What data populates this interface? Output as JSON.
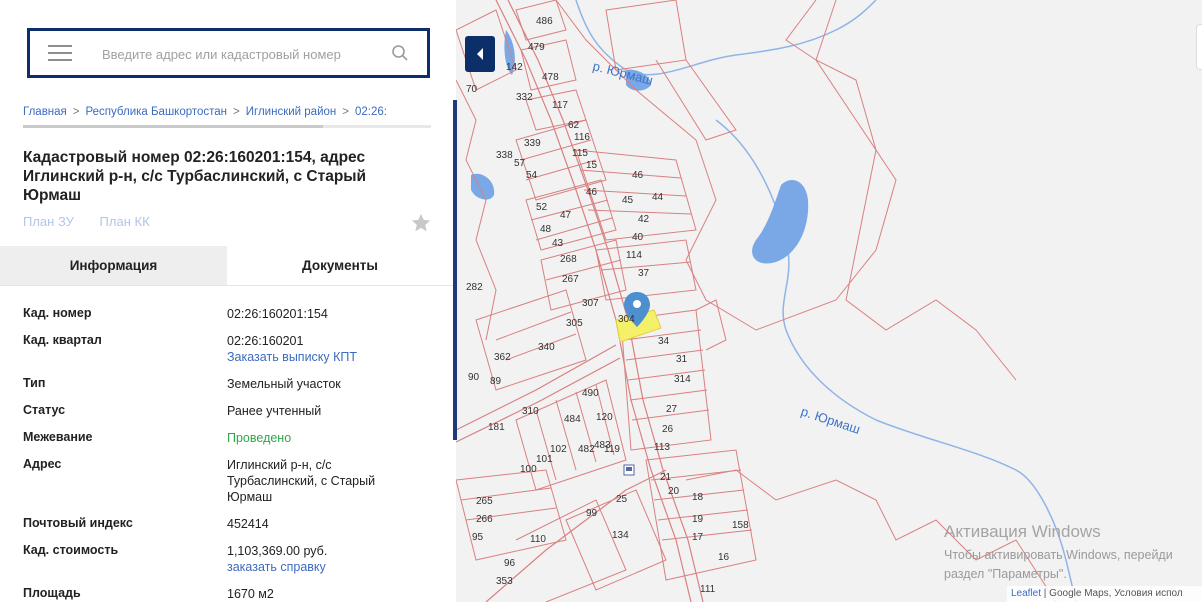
{
  "search": {
    "placeholder": "Введите адрес или кадастровый номер"
  },
  "breadcrumb": {
    "items": [
      "Главная",
      "Республика Башкортостан",
      "Иглинский район",
      "02:26:"
    ],
    "separator": ">"
  },
  "object": {
    "title": "Кадастровый номер 02:26:160201:154, адрес Иглинский р-н, с/с Турбаслинский, с Старый Юрмаш",
    "plan_zu": "План ЗУ",
    "plan_kk": "План КК"
  },
  "tabs": {
    "info": "Информация",
    "docs": "Документы"
  },
  "properties": {
    "cad_number": {
      "label": "Кад. номер",
      "value": "02:26:160201:154"
    },
    "cad_quarter": {
      "label": "Кад. квартал",
      "value": "02:26:160201",
      "link": "Заказать выписку КПТ"
    },
    "type": {
      "label": "Тип",
      "value": "Земельный участок"
    },
    "status": {
      "label": "Статус",
      "value": "Ранее учтенный"
    },
    "survey": {
      "label": "Межевание",
      "value": "Проведено"
    },
    "address": {
      "label": "Адрес",
      "value": "Иглинский р-н, с/с Турбаслинский, с Старый Юрмаш"
    },
    "postcode": {
      "label": "Почтовый индекс",
      "value": "452414"
    },
    "cad_cost": {
      "label": "Кад. стоимость",
      "value": "1,103,369.00 руб.",
      "link": "заказать справку"
    },
    "area": {
      "label": "Площадь",
      "value": "1670 м2"
    }
  },
  "map": {
    "river_label_1": "р. Юрмаш",
    "river_label_2": "р. Юрмаш",
    "parcel_labels": [
      "486",
      "479",
      "478",
      "142",
      "70",
      "332",
      "117",
      "62",
      "116",
      "115",
      "338",
      "339",
      "57",
      "54",
      "15",
      "46",
      "46",
      "45",
      "44",
      "42",
      "52",
      "48",
      "47",
      "43",
      "40",
      "114",
      "37",
      "268",
      "267",
      "282",
      "307",
      "305",
      "304",
      "34",
      "31",
      "314",
      "362",
      "340",
      "90",
      "89",
      "490",
      "484",
      "120",
      "27",
      "26",
      "113",
      "310",
      "181",
      "102",
      "101",
      "482",
      "483",
      "119",
      "100",
      "21",
      "20",
      "18",
      "19",
      "17",
      "16",
      "265",
      "266",
      "95",
      "110",
      "96",
      "353",
      "99",
      "134",
      "158",
      "25",
      "111"
    ],
    "colors": {
      "parcel_stroke": "#d98080",
      "river": "#8fb4e6",
      "lake": "#7aa8e6",
      "selected": "#f5f06a",
      "marker": "#4e8fd0"
    }
  },
  "watermark": {
    "title": "Активация Windows",
    "line1": "Чтобы активировать Windows, перейди",
    "line2": "раздел \"Параметры\"."
  },
  "attribution": {
    "leaflet": "Leaflet",
    "rest": " | Google Maps, Условия испол"
  }
}
